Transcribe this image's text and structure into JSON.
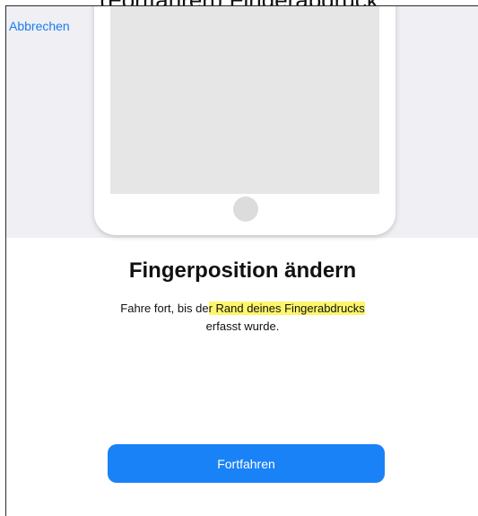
{
  "top_caption": "(Fortfahren) Fingerabdruck",
  "header": {
    "cancel_label": "Abbrechen"
  },
  "title": "Fingerposition ändern",
  "instruction": {
    "part1": "Fahre fort, bis de",
    "highlighted": "r Rand deines Fingerabdrucks",
    "part2": "erfasst wurde."
  },
  "primary_button": {
    "label": "Fortfahren"
  },
  "colors": {
    "accent": "#1a82f7",
    "link": "#1a7cf0",
    "highlight": "#fdf66a",
    "header_bg": "#efeff4"
  },
  "icons": {
    "home_button": "home-button-icon"
  }
}
